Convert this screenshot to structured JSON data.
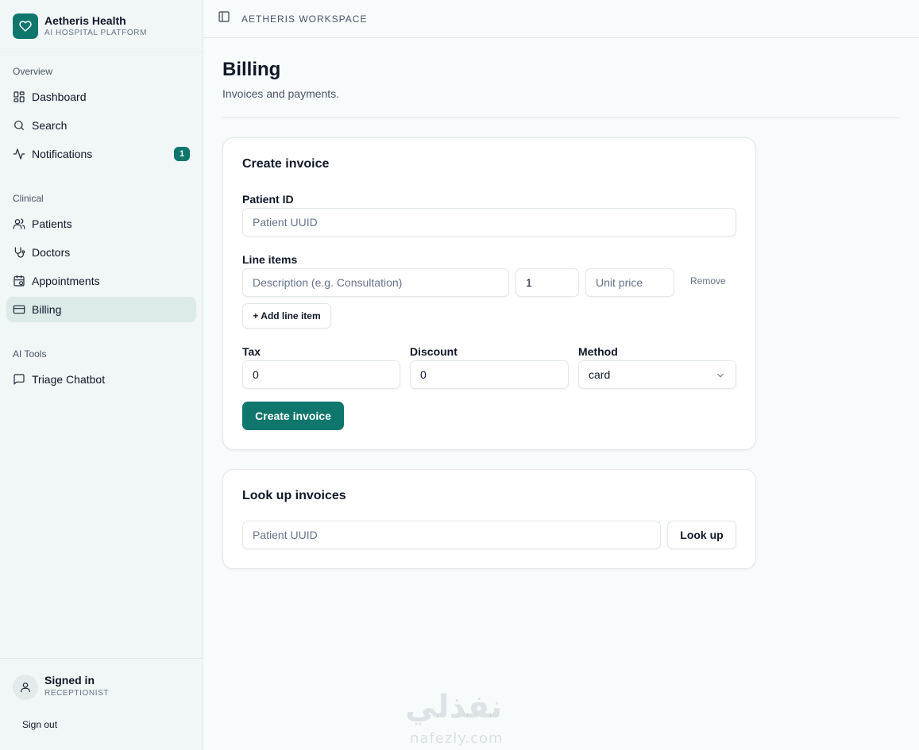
{
  "brand": {
    "name": "Aetheris Health",
    "subtitle": "AI HOSPITAL PLATFORM"
  },
  "sidebar": {
    "sections": [
      {
        "label": "Overview",
        "items": [
          {
            "label": "Dashboard",
            "icon": "dashboard-icon"
          },
          {
            "label": "Search",
            "icon": "search-icon"
          },
          {
            "label": "Notifications",
            "icon": "activity-icon",
            "badge": "1"
          }
        ]
      },
      {
        "label": "Clinical",
        "items": [
          {
            "label": "Patients",
            "icon": "users-icon"
          },
          {
            "label": "Doctors",
            "icon": "stethoscope-icon"
          },
          {
            "label": "Appointments",
            "icon": "calendar-icon"
          },
          {
            "label": "Billing",
            "icon": "credit-card-icon",
            "active": true
          }
        ]
      },
      {
        "label": "AI Tools",
        "items": [
          {
            "label": "Triage Chatbot",
            "icon": "chat-icon"
          }
        ]
      }
    ],
    "user": {
      "status": "Signed in",
      "role": "RECEPTIONIST",
      "signout": "Sign out"
    }
  },
  "topbar": {
    "workspace": "AETHERIS WORKSPACE"
  },
  "page": {
    "title": "Billing",
    "subtitle": "Invoices and payments."
  },
  "create_invoice": {
    "title": "Create invoice",
    "patient_label": "Patient ID",
    "patient_placeholder": "Patient UUID",
    "line_items_label": "Line items",
    "description_placeholder": "Description (e.g. Consultation)",
    "quantity_value": "1",
    "unit_price_placeholder": "Unit price",
    "remove_label": "Remove",
    "add_line_label": "+ Add line item",
    "tax_label": "Tax",
    "tax_value": "0",
    "discount_label": "Discount",
    "discount_value": "0",
    "method_label": "Method",
    "method_value": "card",
    "submit_label": "Create invoice"
  },
  "lookup": {
    "title": "Look up invoices",
    "placeholder": "Patient UUID",
    "button_label": "Look up"
  },
  "watermark": {
    "arabic": "نفذلي",
    "latin": "nafezly.com"
  },
  "colors": {
    "accent": "#0f766e",
    "active_bg": "#dcebe8",
    "sidebar_bg": "#f1f6f6"
  }
}
